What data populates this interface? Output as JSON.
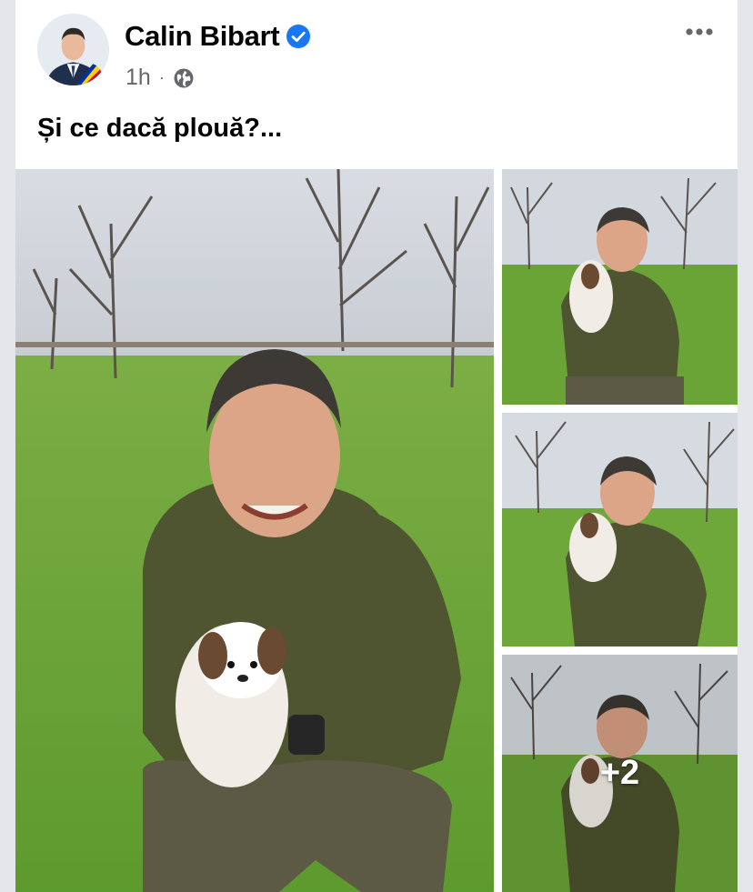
{
  "post": {
    "author": "Calin Bibart",
    "verified": true,
    "time": "1h",
    "separator": "·",
    "audience_icon": "globe-icon",
    "text": "Și ce dacă plouă?...",
    "menu_icon": "more-options-icon"
  },
  "photos": {
    "count_visible": 4,
    "more_label": "+2"
  },
  "colors": {
    "verified_badge": "#1877f2",
    "meta_text": "#65676b",
    "grass": "#6ea63a",
    "jacket": "#4e5530"
  }
}
